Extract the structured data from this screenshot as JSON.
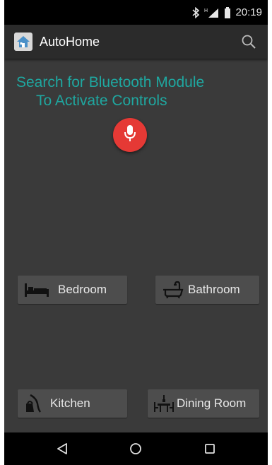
{
  "status_bar": {
    "time": "20:19",
    "icons": [
      "bluetooth-icon",
      "signal-icon",
      "battery-icon"
    ]
  },
  "action_bar": {
    "title": "AutoHome",
    "app_icon": "home-icon",
    "search_icon": "search-icon"
  },
  "prompt": {
    "line1": "Search for Bluetooth Module",
    "line2": "To Activate Controls",
    "color": "#1fa7a0"
  },
  "mic": {
    "icon": "microphone-icon",
    "color": "#e53935"
  },
  "rooms": [
    {
      "label": "Bedroom",
      "icon": "bed-icon"
    },
    {
      "label": "Bathroom",
      "icon": "bathtub-icon"
    },
    {
      "label": "Kitchen",
      "icon": "kitchen-icon"
    },
    {
      "label": "Dining Room",
      "icon": "dining-table-icon"
    }
  ],
  "nav_bar": {
    "back_icon": "back-icon",
    "home_icon": "home-circle-icon",
    "recents_icon": "recents-icon"
  }
}
